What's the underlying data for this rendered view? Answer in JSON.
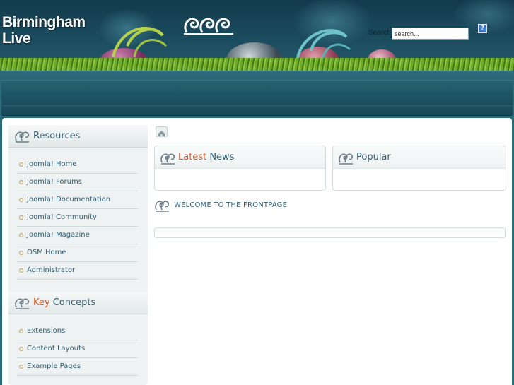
{
  "site": {
    "title_line1": "Birmingham",
    "title_line2": "Live"
  },
  "search": {
    "label": "Search",
    "value": "search...",
    "help_glyph": "?"
  },
  "sidebar": {
    "modules": [
      {
        "title_highlight": "",
        "title_rest": "Resources",
        "icon": "swirl-icon",
        "items": [
          {
            "label": "Joomla! Home"
          },
          {
            "label": "Joomla! Forums"
          },
          {
            "label": "Joomla! Documentation"
          },
          {
            "label": "Joomla! Community"
          },
          {
            "label": "Joomla! Magazine"
          },
          {
            "label": "OSM Home"
          },
          {
            "label": "Administrator"
          }
        ]
      },
      {
        "title_highlight": "Key",
        "title_rest": " Concepts",
        "icon": "swirl-icon",
        "items": [
          {
            "label": "Extensions"
          },
          {
            "label": "Content Layouts"
          },
          {
            "label": "Example Pages"
          }
        ]
      }
    ]
  },
  "main": {
    "home_icon": "home-icon",
    "latest": {
      "title_highlight": "Latest",
      "title_rest": " News"
    },
    "popular": {
      "title": "Popular"
    },
    "welcome": "WELCOME TO THE FRONTPAGE"
  },
  "colors": {
    "accent": "#d6541c",
    "text": "#2f5f74",
    "header_dark": "#123a4c"
  }
}
